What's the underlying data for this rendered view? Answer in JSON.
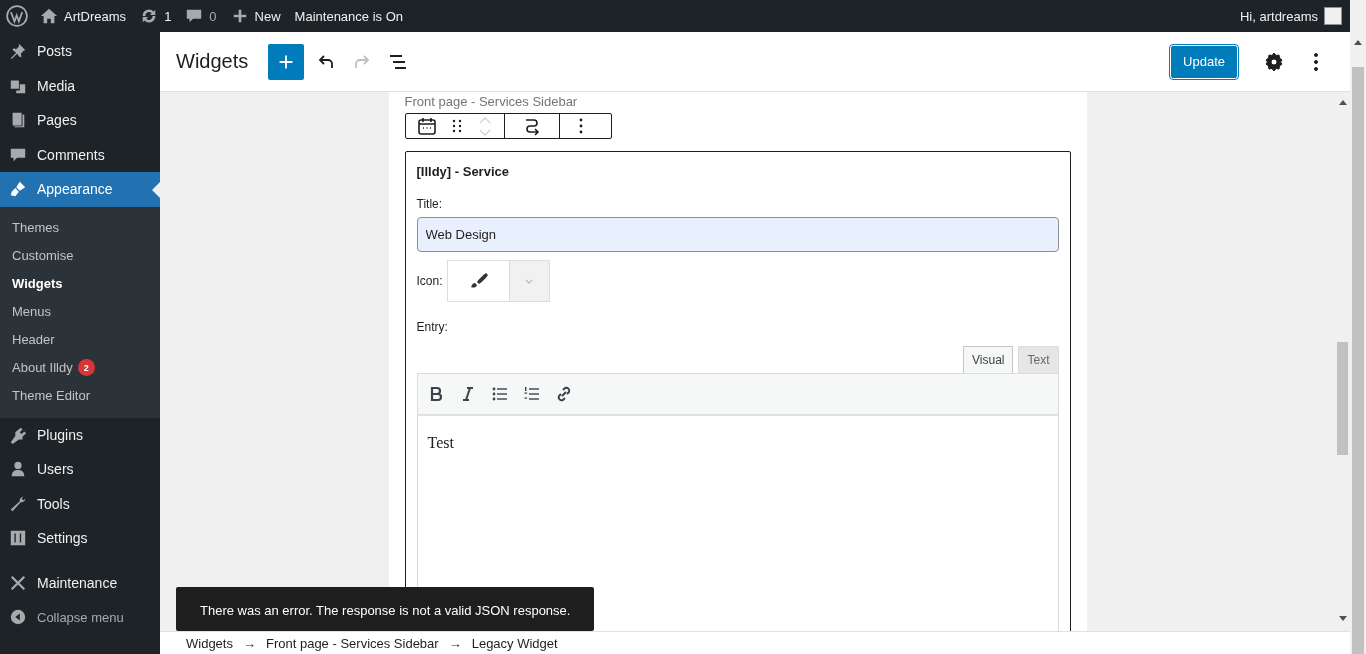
{
  "admin_bar": {
    "site": "ArtDreams",
    "updates": "1",
    "comments": "0",
    "new": "New",
    "maintenance": "Maintenance is On",
    "greeting": "Hi, artdreams"
  },
  "sidebar": {
    "items": [
      {
        "label": "Posts",
        "selected": false
      },
      {
        "label": "Media",
        "selected": false
      },
      {
        "label": "Pages",
        "selected": false
      },
      {
        "label": "Comments",
        "selected": false
      },
      {
        "label": "Appearance",
        "selected": true,
        "children": [
          {
            "label": "Themes",
            "selected": false
          },
          {
            "label": "Customise",
            "selected": false
          },
          {
            "label": "Widgets",
            "selected": true
          },
          {
            "label": "Menus",
            "selected": false
          },
          {
            "label": "Header",
            "selected": false
          },
          {
            "label": "About Illdy",
            "selected": false,
            "badge": "2"
          },
          {
            "label": "Theme Editor",
            "selected": false
          }
        ]
      },
      {
        "label": "Plugins",
        "selected": false
      },
      {
        "label": "Users",
        "selected": false
      },
      {
        "label": "Tools",
        "selected": false
      },
      {
        "label": "Settings",
        "selected": false
      },
      {
        "label": "Maintenance",
        "selected": false
      },
      {
        "label": "Collapse menu",
        "selected": false
      }
    ]
  },
  "header": {
    "title": "Widgets",
    "undo_disabled": false,
    "redo_disabled": true,
    "update": "Update"
  },
  "area_label": "Front page - Services Sidebar",
  "block_toolbar": {
    "move_up_disabled": true,
    "move_down_disabled": true
  },
  "widget": {
    "heading": "[Illdy] - Service",
    "title_label": "Title:",
    "title_value": "Web Design",
    "icon_label": "Icon:",
    "entry_label": "Entry:",
    "tabs": [
      {
        "label": "Visual",
        "selected": true
      },
      {
        "label": "Text",
        "selected": false
      }
    ],
    "content": "Test"
  },
  "notice": "There was an error. The response is not a valid JSON response.",
  "breadcrumbs": [
    "Widgets",
    "→",
    "Front page - Services Sidebar",
    "→",
    "Legacy Widget"
  ]
}
